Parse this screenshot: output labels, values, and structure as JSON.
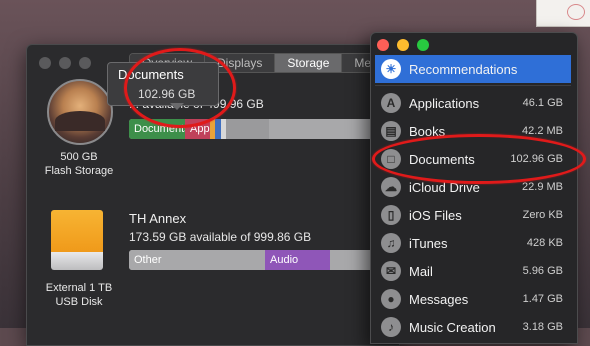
{
  "storage_window": {
    "tabs": [
      "Overview",
      "Displays",
      "Storage",
      "Memory"
    ],
    "active_tab": "Storage",
    "tooltip": {
      "title": "Documents",
      "size": "102.96 GB"
    },
    "disks": [
      {
        "name_line1": "500 GB",
        "name_line2": "Flash Storage",
        "available_text": "... available of 499.96 GB",
        "segments": [
          {
            "label": "Documents",
            "color": "#3d8f4a",
            "fraction": 0.206
          },
          {
            "label": "Apps",
            "color": "#c0415a",
            "fraction": 0.092
          },
          {
            "label": "",
            "color": "#e8a33a",
            "fraction": 0.02
          },
          {
            "label": "",
            "color": "#3f6fc0",
            "fraction": 0.02
          },
          {
            "label": "",
            "color": "#d8d8d8",
            "fraction": 0.01
          },
          {
            "label": "",
            "color": "#9a9a9c",
            "fraction": 0.16
          }
        ]
      },
      {
        "title": "TH Annex",
        "available_text": "173.59 GB available of 999.86 GB",
        "name_line1": "External 1 TB",
        "name_line2": "USB Disk",
        "segments": [
          {
            "label": "Other",
            "color": "#a8a8aa",
            "fraction": 0.5
          },
          {
            "label": "Audio",
            "color": "#8f56b8",
            "fraction": 0.24
          }
        ]
      }
    ]
  },
  "manage_panel": {
    "items": [
      {
        "label": "Recommendations",
        "size": "",
        "icon": "lightbulb-icon",
        "selected": true
      },
      {
        "label": "Applications",
        "size": "46.1 GB",
        "icon": "app-store-icon"
      },
      {
        "label": "Books",
        "size": "42.2 MB",
        "icon": "book-icon"
      },
      {
        "label": "Documents",
        "size": "102.96 GB",
        "icon": "document-icon"
      },
      {
        "label": "iCloud Drive",
        "size": "22.9 MB",
        "icon": "cloud-icon"
      },
      {
        "label": "iOS Files",
        "size": "Zero KB",
        "icon": "phone-icon"
      },
      {
        "label": "iTunes",
        "size": "428 KB",
        "icon": "music-note-icon"
      },
      {
        "label": "Mail",
        "size": "5.96 GB",
        "icon": "mail-icon"
      },
      {
        "label": "Messages",
        "size": "1.47 GB",
        "icon": "speech-bubble-icon"
      },
      {
        "label": "Music Creation",
        "size": "3.18 GB",
        "icon": "guitar-icon"
      }
    ]
  },
  "annotation": {
    "color": "#e01a1a"
  }
}
